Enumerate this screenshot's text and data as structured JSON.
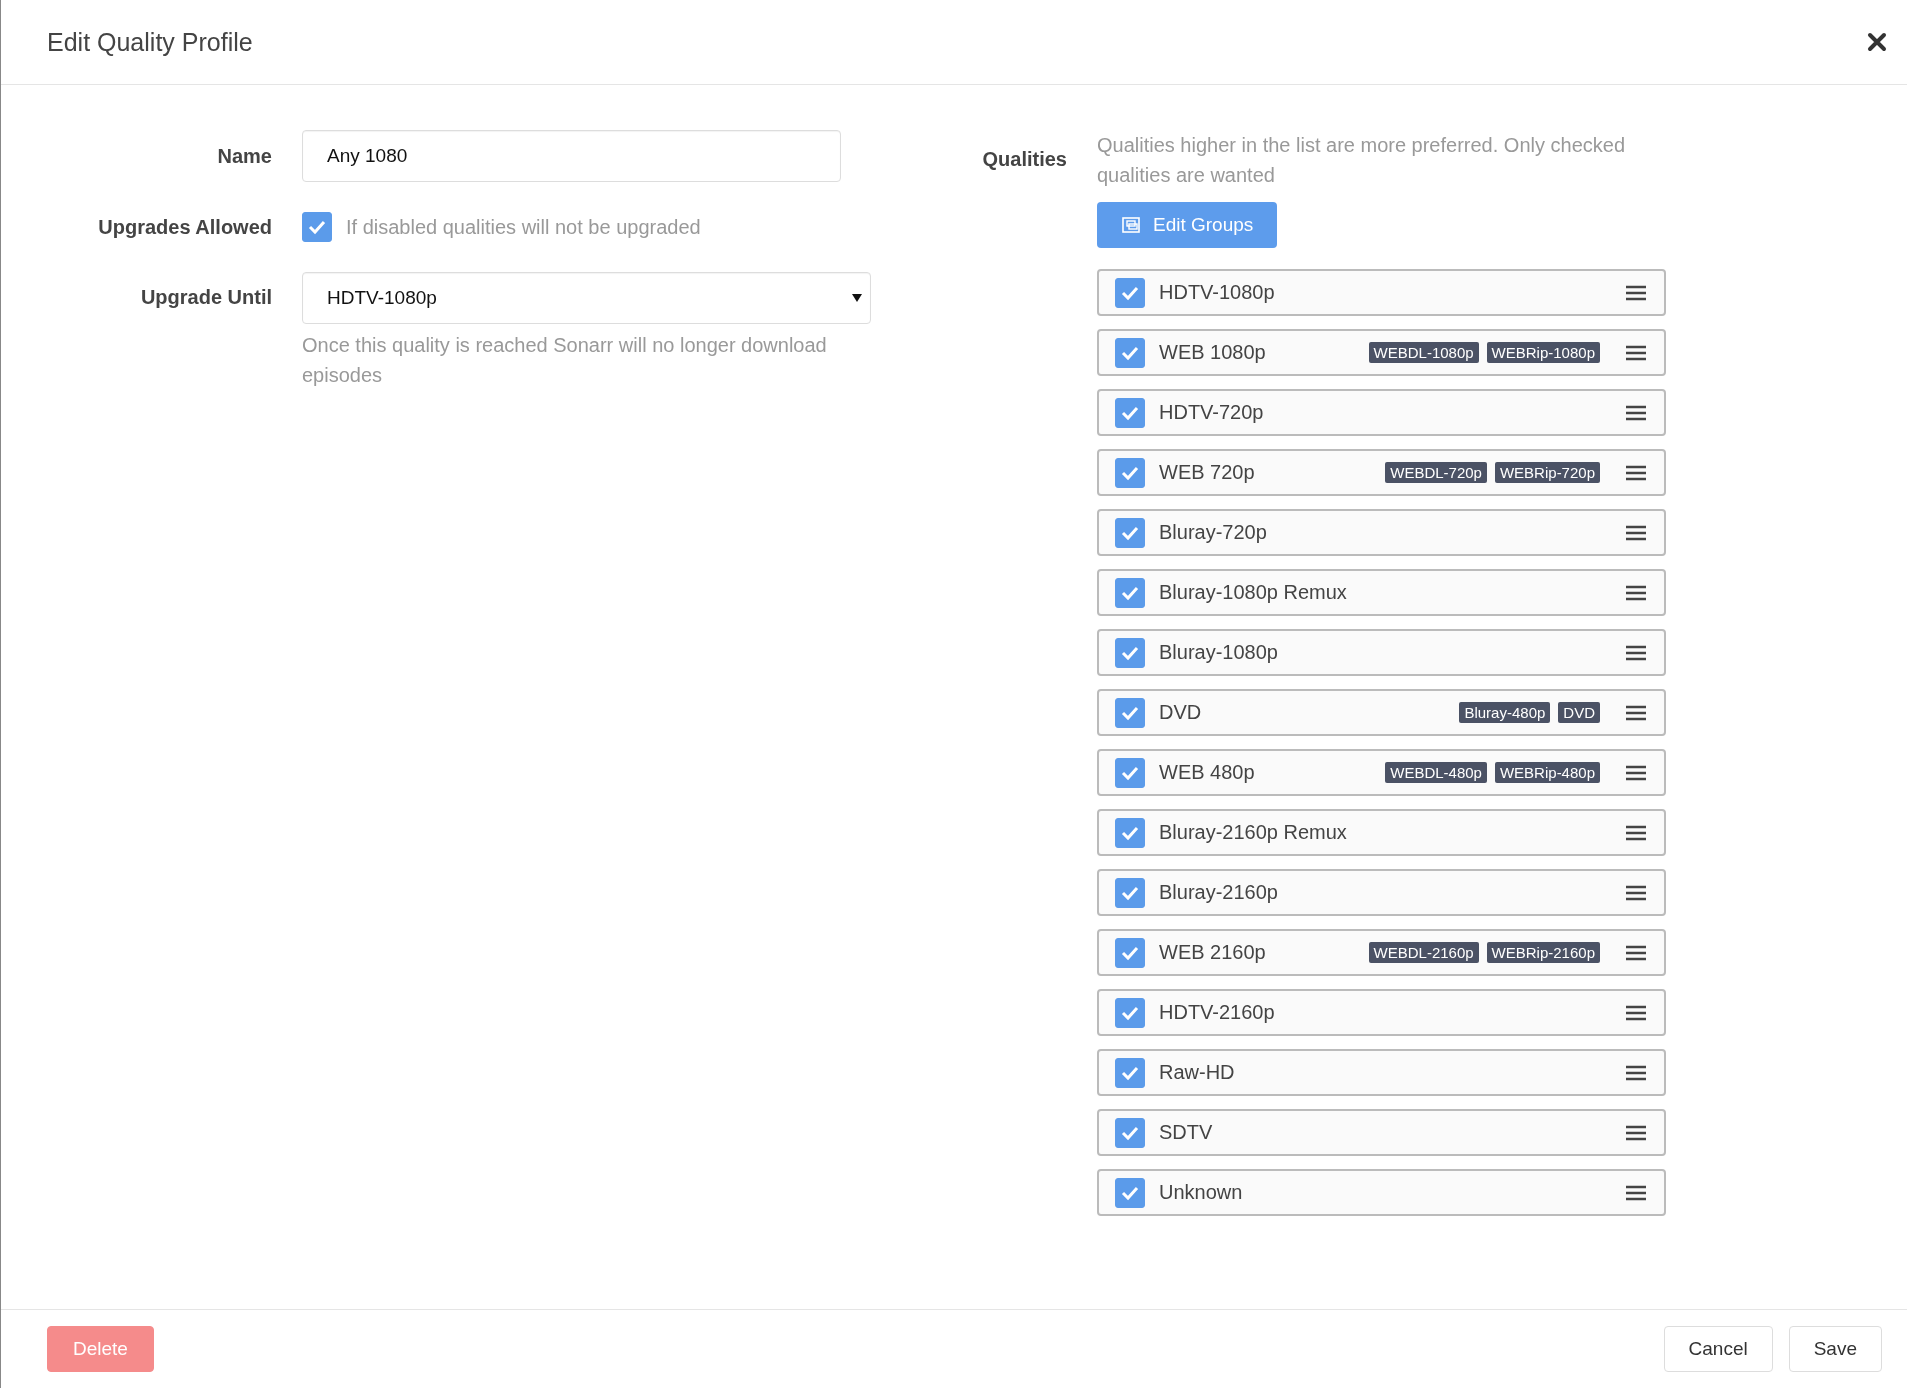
{
  "title": "Edit Quality Profile",
  "name_field": {
    "label": "Name",
    "value": "Any 1080"
  },
  "upgrades_allowed": {
    "label": "Upgrades Allowed",
    "checked": true,
    "help": "If disabled qualities will not be upgraded"
  },
  "upgrade_until": {
    "label": "Upgrade Until",
    "value": "HDTV-1080p",
    "help": "Once this quality is reached Sonarr will no longer download episodes"
  },
  "qualities": {
    "label": "Qualities",
    "help": "Qualities higher in the list are more preferred. Only checked qualities are wanted",
    "edit_groups_button": "Edit Groups",
    "items": [
      {
        "name": "HDTV-1080p",
        "checked": true
      },
      {
        "name": "WEB 1080p",
        "checked": true,
        "tags": [
          "WEBDL-1080p",
          "WEBRip-1080p"
        ]
      },
      {
        "name": "HDTV-720p",
        "checked": true
      },
      {
        "name": "WEB 720p",
        "checked": true,
        "tags": [
          "WEBDL-720p",
          "WEBRip-720p"
        ]
      },
      {
        "name": "Bluray-720p",
        "checked": true
      },
      {
        "name": "Bluray-1080p Remux",
        "checked": true
      },
      {
        "name": "Bluray-1080p",
        "checked": true
      },
      {
        "name": "DVD",
        "checked": true,
        "tags": [
          "Bluray-480p",
          "DVD"
        ]
      },
      {
        "name": "WEB 480p",
        "checked": true,
        "tags": [
          "WEBDL-480p",
          "WEBRip-480p"
        ]
      },
      {
        "name": "Bluray-2160p Remux",
        "checked": true
      },
      {
        "name": "Bluray-2160p",
        "checked": true
      },
      {
        "name": "WEB 2160p",
        "checked": true,
        "tags": [
          "WEBDL-2160p",
          "WEBRip-2160p"
        ]
      },
      {
        "name": "HDTV-2160p",
        "checked": true
      },
      {
        "name": "Raw-HD",
        "checked": true
      },
      {
        "name": "SDTV",
        "checked": true
      },
      {
        "name": "Unknown",
        "checked": true
      }
    ]
  },
  "footer": {
    "delete_button": "Delete",
    "cancel_button": "Cancel",
    "save_button": "Save"
  }
}
